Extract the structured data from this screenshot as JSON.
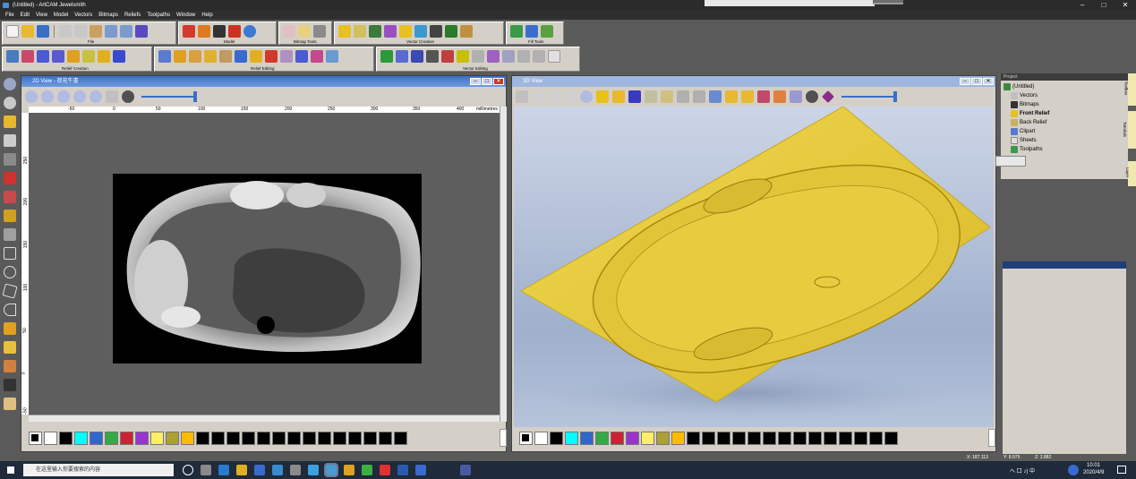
{
  "window": {
    "title": "(Untitled) - ArtCAM Jewelsmith",
    "controls": [
      "–",
      "□",
      "✕"
    ]
  },
  "menu": [
    "File",
    "Edit",
    "View",
    "Model",
    "Vectors",
    "Bitmaps",
    "Reliefs",
    "Toolpaths",
    "Window",
    "Help"
  ],
  "toolbars": {
    "file": "File",
    "model": "Model",
    "bitmap_tools": "Bitmap Tools",
    "vector_creation": "Vector Creation",
    "fill_tools": "Fill Tools",
    "relief_creation": "Relief Creation",
    "relief_editing": "Relief Editing",
    "vector_editing": "Vector Editing"
  },
  "view2d": {
    "title": "2D View - 荷花牛書",
    "ruler_ticks": [
      "-50",
      "0",
      "50",
      "100",
      "150",
      "200",
      "250",
      "300",
      "350",
      "400"
    ],
    "ruler_unit": "millimetres",
    "vruler_ticks": [
      "250",
      "200",
      "150",
      "100",
      "50",
      "0",
      "-50"
    ]
  },
  "view3d": {
    "title": "3D View"
  },
  "project": {
    "title": "Project",
    "items": [
      "(Untitled)",
      "Vectors",
      "Bitmaps",
      "Front Relief",
      "Back Relief",
      "Clipart",
      "Sheets",
      "Toolpaths"
    ]
  },
  "side_tabs": [
    "Toolbox",
    "Tutorials",
    "Layer"
  ],
  "status": {
    "x": "X: 187.113",
    "y": "Y: 8.975",
    "z": "Z: 2.882"
  },
  "taskbar": {
    "search_placeholder": "在这里输入你要搜索的内容",
    "tray_text": "へ 口 ♪) 中",
    "time": "10:01",
    "date": "2020/4/9"
  },
  "palette_colors": [
    "#ffffff",
    "#000000",
    "#00ffff",
    "#3366cc",
    "#33aa44",
    "#cc2233",
    "#9933cc",
    "#ffee66",
    "#aaa033",
    "#ffbb00",
    "#000000",
    "#000000",
    "#000000",
    "#000000",
    "#000000",
    "#000000",
    "#000000",
    "#000000",
    "#000000",
    "#000000",
    "#000000",
    "#000000",
    "#000000",
    "#000000"
  ],
  "accent": {
    "relief_gold": "#e6c93a",
    "title_blue": "#3a6fc8"
  }
}
